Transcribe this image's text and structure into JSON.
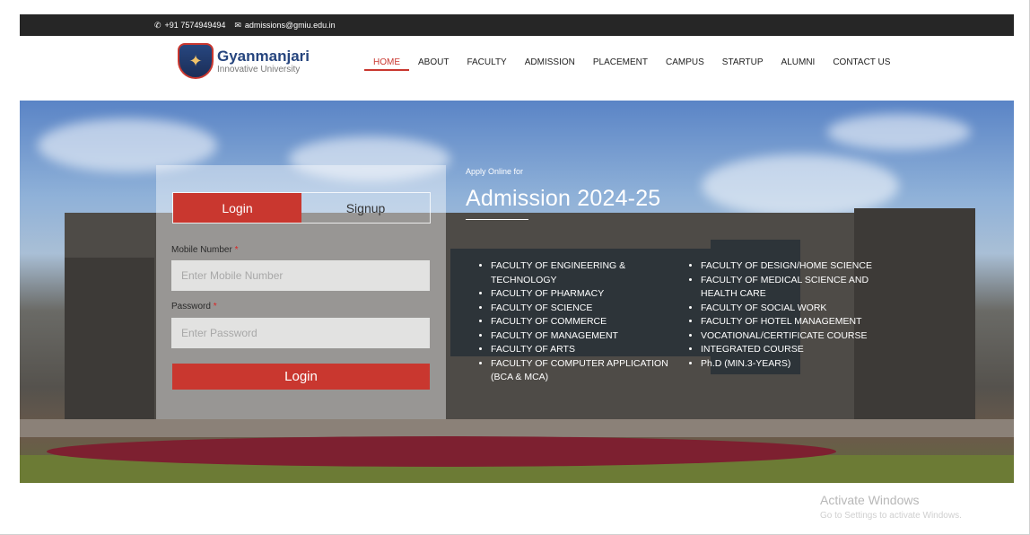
{
  "topbar": {
    "phone": "+91 7574949494",
    "email": "admissions@gmiu.edu.in"
  },
  "logo": {
    "name": "Gyanmanjari",
    "tagline": "Innovative University"
  },
  "nav": {
    "items": [
      "HOME",
      "ABOUT",
      "FACULTY",
      "ADMISSION",
      "PLACEMENT",
      "CAMPUS",
      "STARTUP",
      "ALUMNI",
      "CONTACT US"
    ],
    "active": "HOME"
  },
  "login": {
    "tab_login": "Login",
    "tab_signup": "Signup",
    "mobile_label": "Mobile Number",
    "mobile_placeholder": "Enter Mobile Number",
    "password_label": "Password",
    "password_placeholder": "Enter Password",
    "required_mark": "*",
    "submit_label": "Login"
  },
  "admission": {
    "apply_text": "Apply Online for",
    "title": "Admission 2024-25",
    "faculties_left": [
      "FACULTY OF ENGINEERING & TECHNOLOGY",
      "FACULTY OF PHARMACY",
      "FACULTY OF SCIENCE",
      "FACULTY OF COMMERCE",
      "FACULTY OF MANAGEMENT",
      "FACULTY OF ARTS",
      "FACULTY OF COMPUTER APPLICATION (BCA & MCA)"
    ],
    "faculties_right": [
      "FACULTY OF DESIGN/HOME SCIENCE",
      "FACULTY OF MEDICAL SCIENCE AND HEALTH CARE",
      "FACULTY OF SOCIAL WORK",
      "FACULTY OF HOTEL MANAGEMENT",
      "VOCATIONAL/CERTIFICATE COURSE",
      "INTEGRATED COURSE",
      "Ph.D (MIN.3-YEARS)"
    ]
  },
  "watermark": {
    "title": "Activate Windows",
    "subtitle": "Go to Settings to activate Windows."
  },
  "colors": {
    "accent": "#c9372f",
    "brand": "#26457e",
    "topbar": "#262626"
  }
}
